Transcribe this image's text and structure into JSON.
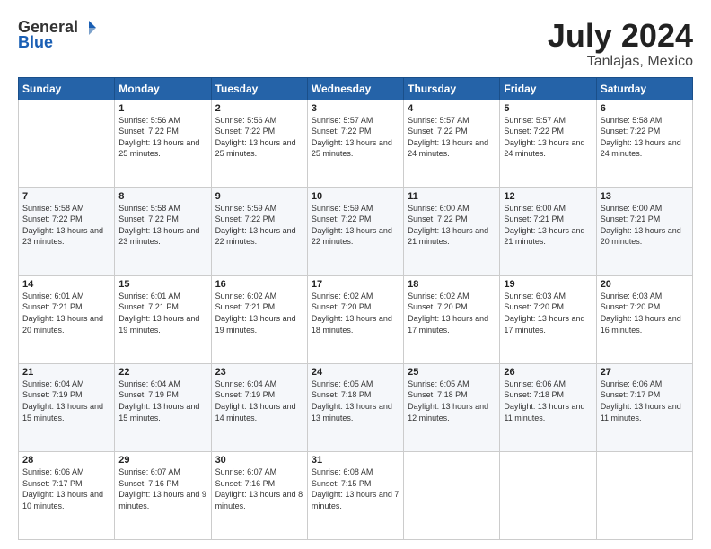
{
  "header": {
    "logo_general": "General",
    "logo_blue": "Blue",
    "month_title": "July 2024",
    "location": "Tanlajas, Mexico"
  },
  "weekdays": [
    "Sunday",
    "Monday",
    "Tuesday",
    "Wednesday",
    "Thursday",
    "Friday",
    "Saturday"
  ],
  "weeks": [
    [
      {
        "day": "",
        "sunrise": "",
        "sunset": "",
        "daylight": ""
      },
      {
        "day": "1",
        "sunrise": "Sunrise: 5:56 AM",
        "sunset": "Sunset: 7:22 PM",
        "daylight": "Daylight: 13 hours and 25 minutes."
      },
      {
        "day": "2",
        "sunrise": "Sunrise: 5:56 AM",
        "sunset": "Sunset: 7:22 PM",
        "daylight": "Daylight: 13 hours and 25 minutes."
      },
      {
        "day": "3",
        "sunrise": "Sunrise: 5:57 AM",
        "sunset": "Sunset: 7:22 PM",
        "daylight": "Daylight: 13 hours and 25 minutes."
      },
      {
        "day": "4",
        "sunrise": "Sunrise: 5:57 AM",
        "sunset": "Sunset: 7:22 PM",
        "daylight": "Daylight: 13 hours and 24 minutes."
      },
      {
        "day": "5",
        "sunrise": "Sunrise: 5:57 AM",
        "sunset": "Sunset: 7:22 PM",
        "daylight": "Daylight: 13 hours and 24 minutes."
      },
      {
        "day": "6",
        "sunrise": "Sunrise: 5:58 AM",
        "sunset": "Sunset: 7:22 PM",
        "daylight": "Daylight: 13 hours and 24 minutes."
      }
    ],
    [
      {
        "day": "7",
        "sunrise": "Sunrise: 5:58 AM",
        "sunset": "Sunset: 7:22 PM",
        "daylight": "Daylight: 13 hours and 23 minutes."
      },
      {
        "day": "8",
        "sunrise": "Sunrise: 5:58 AM",
        "sunset": "Sunset: 7:22 PM",
        "daylight": "Daylight: 13 hours and 23 minutes."
      },
      {
        "day": "9",
        "sunrise": "Sunrise: 5:59 AM",
        "sunset": "Sunset: 7:22 PM",
        "daylight": "Daylight: 13 hours and 22 minutes."
      },
      {
        "day": "10",
        "sunrise": "Sunrise: 5:59 AM",
        "sunset": "Sunset: 7:22 PM",
        "daylight": "Daylight: 13 hours and 22 minutes."
      },
      {
        "day": "11",
        "sunrise": "Sunrise: 6:00 AM",
        "sunset": "Sunset: 7:22 PM",
        "daylight": "Daylight: 13 hours and 21 minutes."
      },
      {
        "day": "12",
        "sunrise": "Sunrise: 6:00 AM",
        "sunset": "Sunset: 7:21 PM",
        "daylight": "Daylight: 13 hours and 21 minutes."
      },
      {
        "day": "13",
        "sunrise": "Sunrise: 6:00 AM",
        "sunset": "Sunset: 7:21 PM",
        "daylight": "Daylight: 13 hours and 20 minutes."
      }
    ],
    [
      {
        "day": "14",
        "sunrise": "Sunrise: 6:01 AM",
        "sunset": "Sunset: 7:21 PM",
        "daylight": "Daylight: 13 hours and 20 minutes."
      },
      {
        "day": "15",
        "sunrise": "Sunrise: 6:01 AM",
        "sunset": "Sunset: 7:21 PM",
        "daylight": "Daylight: 13 hours and 19 minutes."
      },
      {
        "day": "16",
        "sunrise": "Sunrise: 6:02 AM",
        "sunset": "Sunset: 7:21 PM",
        "daylight": "Daylight: 13 hours and 19 minutes."
      },
      {
        "day": "17",
        "sunrise": "Sunrise: 6:02 AM",
        "sunset": "Sunset: 7:20 PM",
        "daylight": "Daylight: 13 hours and 18 minutes."
      },
      {
        "day": "18",
        "sunrise": "Sunrise: 6:02 AM",
        "sunset": "Sunset: 7:20 PM",
        "daylight": "Daylight: 13 hours and 17 minutes."
      },
      {
        "day": "19",
        "sunrise": "Sunrise: 6:03 AM",
        "sunset": "Sunset: 7:20 PM",
        "daylight": "Daylight: 13 hours and 17 minutes."
      },
      {
        "day": "20",
        "sunrise": "Sunrise: 6:03 AM",
        "sunset": "Sunset: 7:20 PM",
        "daylight": "Daylight: 13 hours and 16 minutes."
      }
    ],
    [
      {
        "day": "21",
        "sunrise": "Sunrise: 6:04 AM",
        "sunset": "Sunset: 7:19 PM",
        "daylight": "Daylight: 13 hours and 15 minutes."
      },
      {
        "day": "22",
        "sunrise": "Sunrise: 6:04 AM",
        "sunset": "Sunset: 7:19 PM",
        "daylight": "Daylight: 13 hours and 15 minutes."
      },
      {
        "day": "23",
        "sunrise": "Sunrise: 6:04 AM",
        "sunset": "Sunset: 7:19 PM",
        "daylight": "Daylight: 13 hours and 14 minutes."
      },
      {
        "day": "24",
        "sunrise": "Sunrise: 6:05 AM",
        "sunset": "Sunset: 7:18 PM",
        "daylight": "Daylight: 13 hours and 13 minutes."
      },
      {
        "day": "25",
        "sunrise": "Sunrise: 6:05 AM",
        "sunset": "Sunset: 7:18 PM",
        "daylight": "Daylight: 13 hours and 12 minutes."
      },
      {
        "day": "26",
        "sunrise": "Sunrise: 6:06 AM",
        "sunset": "Sunset: 7:18 PM",
        "daylight": "Daylight: 13 hours and 11 minutes."
      },
      {
        "day": "27",
        "sunrise": "Sunrise: 6:06 AM",
        "sunset": "Sunset: 7:17 PM",
        "daylight": "Daylight: 13 hours and 11 minutes."
      }
    ],
    [
      {
        "day": "28",
        "sunrise": "Sunrise: 6:06 AM",
        "sunset": "Sunset: 7:17 PM",
        "daylight": "Daylight: 13 hours and 10 minutes."
      },
      {
        "day": "29",
        "sunrise": "Sunrise: 6:07 AM",
        "sunset": "Sunset: 7:16 PM",
        "daylight": "Daylight: 13 hours and 9 minutes."
      },
      {
        "day": "30",
        "sunrise": "Sunrise: 6:07 AM",
        "sunset": "Sunset: 7:16 PM",
        "daylight": "Daylight: 13 hours and 8 minutes."
      },
      {
        "day": "31",
        "sunrise": "Sunrise: 6:08 AM",
        "sunset": "Sunset: 7:15 PM",
        "daylight": "Daylight: 13 hours and 7 minutes."
      },
      {
        "day": "",
        "sunrise": "",
        "sunset": "",
        "daylight": ""
      },
      {
        "day": "",
        "sunrise": "",
        "sunset": "",
        "daylight": ""
      },
      {
        "day": "",
        "sunrise": "",
        "sunset": "",
        "daylight": ""
      }
    ]
  ]
}
